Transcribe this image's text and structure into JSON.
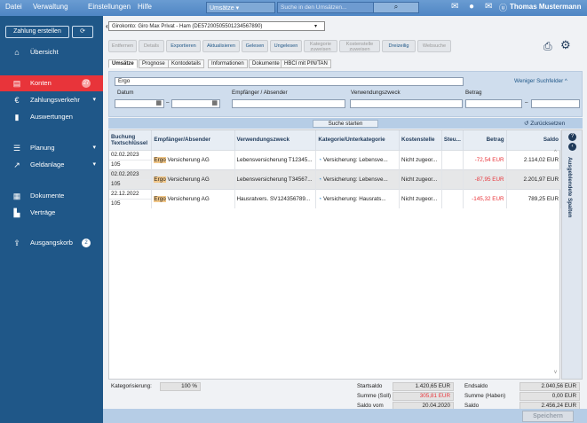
{
  "menubar": {
    "items": [
      "Datei",
      "Verwaltung",
      "Einstellungen",
      "Hilfe"
    ],
    "user": "Thomas Mustermann"
  },
  "topsearch": {
    "scope": "Umsätze",
    "placeholder": "Suche in den Umsätzen..."
  },
  "sidebar": {
    "create_button": "Zahlung erstellen",
    "items": [
      {
        "label": "Übersicht"
      },
      {
        "label": "Konten",
        "badge": "27"
      },
      {
        "label": "Zahlungsverkehr"
      },
      {
        "label": "Auswertungen"
      },
      {
        "label": "Planung"
      },
      {
        "label": "Geldanlage"
      },
      {
        "label": "Dokumente"
      },
      {
        "label": "Verträge"
      },
      {
        "label": "Ausgangskorb",
        "badge": "2"
      }
    ]
  },
  "account": {
    "selected": "Girokonto: Giro Max Privat - Ham (DE57200505501234567890)"
  },
  "toolbar": {
    "entfernen": "Entfernen",
    "details": "Details",
    "exportieren": "Exportieren",
    "aktualisieren": "Aktualisieren",
    "gelesen": "Gelesen",
    "ungelesen": "Ungelesen",
    "kategorie_1": "Kategorie",
    "kategorie_2": "zuweisen",
    "kostenstelle_1": "Kostenstelle",
    "kostenstelle_2": "zuweisen",
    "dreizeilig": "Dreizeilig",
    "websuche": "Websuche"
  },
  "tabs": [
    "Umsätze",
    "Prognose",
    "Kontodetails",
    "Informationen",
    "Dokumente",
    "HBCI mit PIN/TAN"
  ],
  "filter": {
    "search_value": "Ergo",
    "fewer_fields": "Weniger Suchfelder ^",
    "datum": "Datum",
    "empfaenger": "Empfänger / Absender",
    "verwendungszweck": "Verwendungszweck",
    "betrag": "Betrag",
    "dash": "–",
    "start": "Suche starten",
    "reset": "Zurücksetzen"
  },
  "table": {
    "headers": {
      "buchung": "Buchung",
      "textschluessel": "Textschlüssel",
      "empfaenger": "Empfänger/Absender",
      "verwendungszweck": "Verwendungszweck",
      "kategorie": "Kategorie/Unterkategorie",
      "kostenstelle": "Kostenstelle",
      "steuer": "Steu...",
      "betrag": "Betrag",
      "saldo": "Saldo"
    },
    "rows": [
      {
        "date": "02.02.2023",
        "key": "105",
        "payee_hl": "Ergo",
        "payee_rest": " Versicherung AG",
        "purpose": "Lebensversicherung T12345...",
        "category": "Versicherung: Lebensve...",
        "cost": "Nicht zugeor...",
        "tax": "",
        "amount": "-72,54 EUR",
        "balance": "2.114,02 EUR"
      },
      {
        "date": "02.02.2023",
        "key": "105",
        "payee_hl": "Ergo",
        "payee_rest": " Versicherung AG",
        "purpose": "Lebensversicherung T34567...",
        "category": "Versicherung: Lebensve...",
        "cost": "Nicht zugeor...",
        "tax": "",
        "amount": "-87,95 EUR",
        "balance": "2.201,97 EUR"
      },
      {
        "date": "22.12.2022",
        "key": "105",
        "payee_hl": "Ergo",
        "payee_rest": " Versicherung AG",
        "purpose": "Hausratvers. SV124356789...",
        "category": "Versicherung: Hausrats...",
        "cost": "Nicht zugeor...",
        "tax": "",
        "amount": "-145,32 EUR",
        "balance": "789,25 EUR"
      }
    ],
    "side_label": "Ausgeblendete Spalten"
  },
  "footer": {
    "kategorisierung": "Kategorisierung:",
    "kategorisierung_value": "100 %",
    "startsaldo": "Startsaldo",
    "startsaldo_value": "1.420,65 EUR",
    "endsaldo": "Endsaldo",
    "endsaldo_value": "2.040,56 EUR",
    "soll": "Summe (Soll)",
    "soll_value": "305,81 EUR",
    "haben": "Summe (Haben)",
    "haben_value": "0,00 EUR",
    "saldo_vom": "Saldo vom",
    "saldo_vom_value": "20.04.2020",
    "saldo": "Saldo",
    "saldo_value": "2.456,24 EUR"
  },
  "save": "Speichern",
  "colors": {
    "sidebar": "#1f5788",
    "active": "#e8343a",
    "highlight": "#f2c88a"
  }
}
